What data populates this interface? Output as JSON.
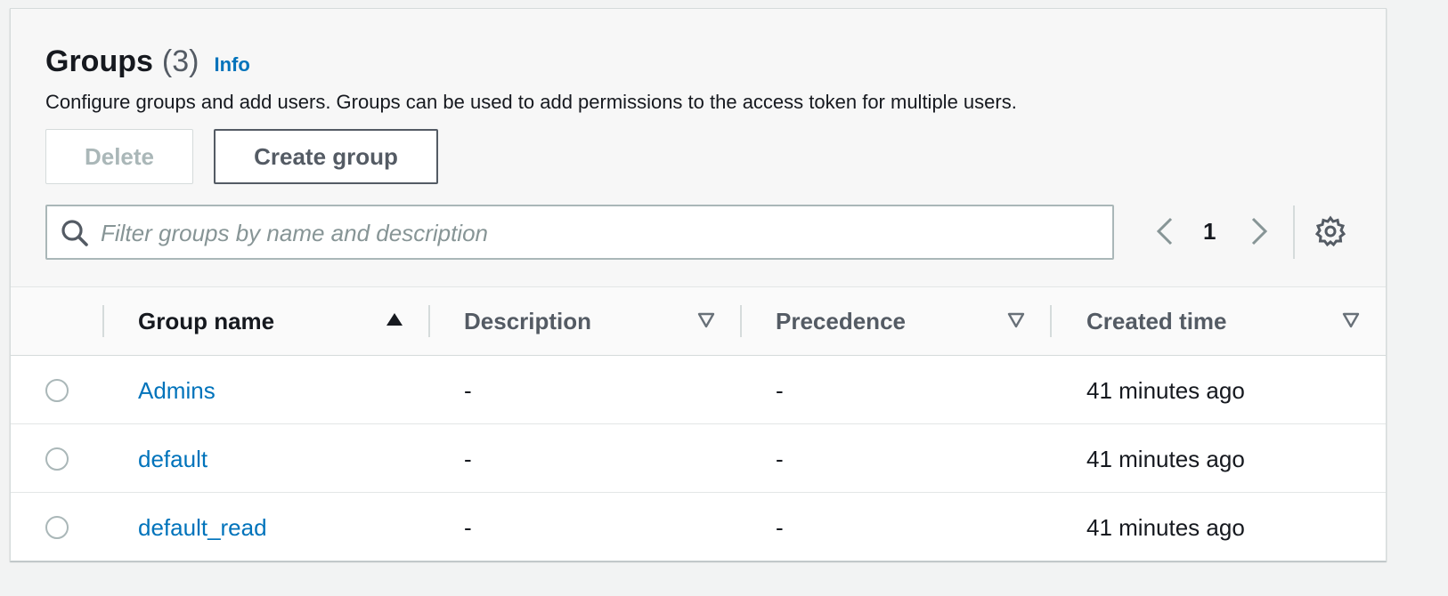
{
  "header": {
    "title": "Groups",
    "count": "(3)",
    "info": "Info",
    "description": "Configure groups and add users. Groups can be used to add permissions to the access token for multiple users."
  },
  "actions": {
    "delete_label": "Delete",
    "create_label": "Create group"
  },
  "search": {
    "placeholder": "Filter groups by name and description",
    "value": ""
  },
  "pagination": {
    "current_page": "1"
  },
  "table": {
    "columns": [
      {
        "label": "Group name",
        "sort": "ascending"
      },
      {
        "label": "Description",
        "sort": "none"
      },
      {
        "label": "Precedence",
        "sort": "none"
      },
      {
        "label": "Created time",
        "sort": "none"
      }
    ],
    "rows": [
      {
        "name": "Admins",
        "description": "-",
        "precedence": "-",
        "created": "41 minutes ago",
        "selected": false
      },
      {
        "name": "default",
        "description": "-",
        "precedence": "-",
        "created": "41 minutes ago",
        "selected": false
      },
      {
        "name": "default_read",
        "description": "-",
        "precedence": "-",
        "created": "41 minutes ago",
        "selected": false
      }
    ]
  },
  "icons": {
    "search": "search-icon",
    "prev": "chevron-left-icon",
    "next": "chevron-right-icon",
    "settings": "gear-icon",
    "sort_active": "caret-up-filled-icon",
    "sort_inactive": "caret-down-outline-icon"
  },
  "colors": {
    "link": "#0073bb",
    "text": "#16191f",
    "muted_text": "#545b64",
    "disabled": "#aab7b8",
    "border": "#d5dbdb",
    "header_bg": "#f7f7f7"
  }
}
